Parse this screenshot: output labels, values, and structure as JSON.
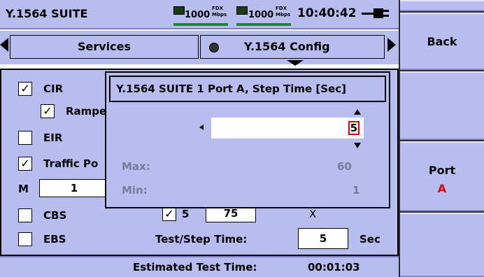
{
  "header": {
    "title": "Y.1564 SUITE",
    "link1_speed": "1000",
    "link1_mode": "FDX",
    "link1_unit": "Mbps",
    "link2_speed": "1000",
    "link2_mode": "FDX",
    "link2_unit": "Mbps",
    "time": "10:40:42",
    "icons": [
      "port-status-icon",
      "port-status-icon",
      "power-plug-icon"
    ]
  },
  "tabs": {
    "left": "Services",
    "right": "Y.1564 Config",
    "right_icon": "disc-icon"
  },
  "form": {
    "cir": "CIR",
    "ramp": "Rampe",
    "eir": "EIR",
    "traffic": "Traffic Po",
    "m_label": "M",
    "m_value": "1",
    "cbs": "CBS",
    "step_value": "5",
    "step_field": "75",
    "x_mark": "X",
    "ebs": "EBS",
    "test_step_label": "Test/Step Time:",
    "test_step_value": "5",
    "test_step_unit": "Sec",
    "checked": {
      "cir": true,
      "ramp": true,
      "eir": false,
      "traffic": true,
      "cbs": false,
      "step": true,
      "ebs": false
    }
  },
  "footer": {
    "estimated_label": "Estimated Test Time:",
    "estimated_value": "00:01:03"
  },
  "dialog": {
    "title": "Y.1564 SUITE 1 Port A, Step Time [Sec]",
    "value": "5",
    "max_label": "Max:",
    "max_value": "60",
    "min_label": "Min:",
    "min_value": "1"
  },
  "side": {
    "back": "Back",
    "port_label": "Port",
    "port_value": "A"
  },
  "colors": {
    "panel": "#b8bdf0",
    "accent_red": "#e00000",
    "link_green": "#1a8a2a"
  }
}
